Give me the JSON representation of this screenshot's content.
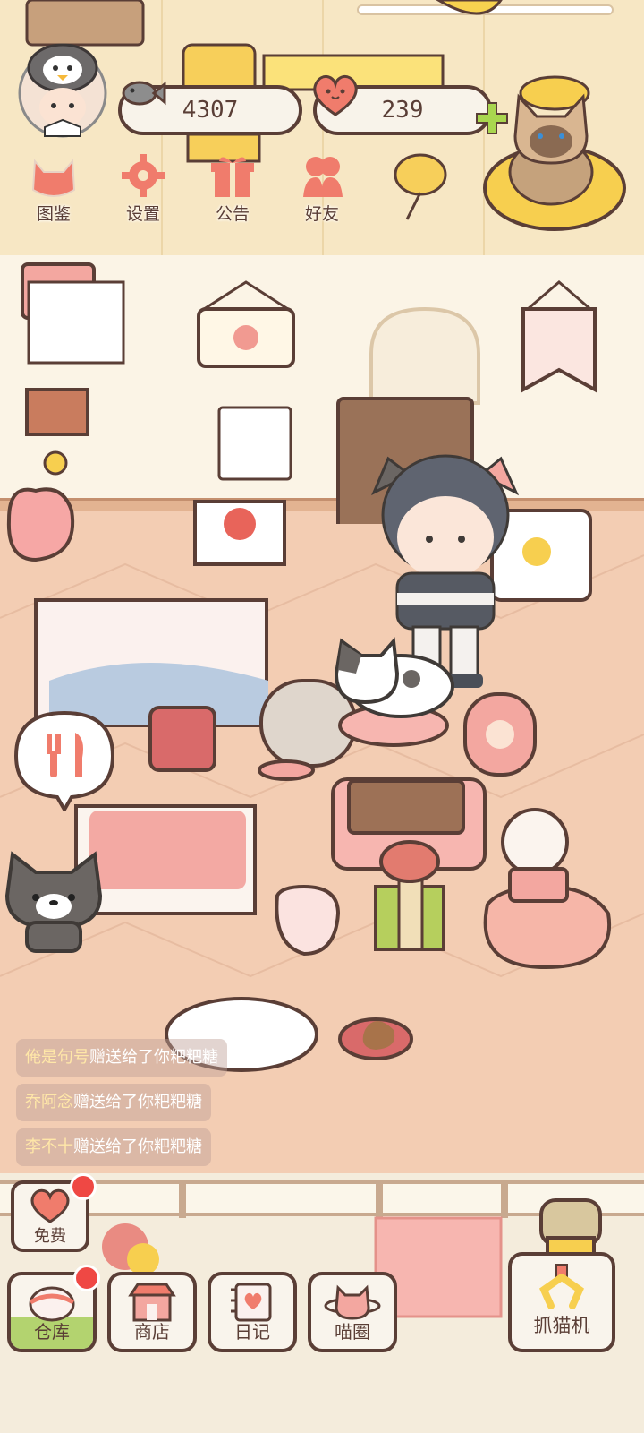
{
  "currency": {
    "fish_coins": "4307",
    "hearts": "239"
  },
  "menu": [
    {
      "label": "图鉴",
      "icon": "cat-head-icon"
    },
    {
      "label": "设置",
      "icon": "gear-icon"
    },
    {
      "label": "公告",
      "icon": "gift-icon"
    },
    {
      "label": "好友",
      "icon": "friends-icon"
    }
  ],
  "chat": [
    {
      "name": "俺是句号",
      "text": "赠送给了你粑粑糖"
    },
    {
      "name": "乔阿念",
      "text": "赠送给了你粑粑糖"
    },
    {
      "name": "李不十",
      "text": "赠送给了你粑粑糖"
    }
  ],
  "free_button": {
    "label": "免费"
  },
  "bottom_bar": [
    {
      "label": "仓库",
      "icon": "warehouse-icon"
    },
    {
      "label": "商店",
      "icon": "shop-icon"
    },
    {
      "label": "日记",
      "icon": "diary-icon"
    },
    {
      "label": "喵圈",
      "icon": "cat-planet-icon"
    }
  ],
  "claw_machine": {
    "label": "抓猫机",
    "icon": "claw-icon"
  },
  "colors": {
    "outline": "#5a3e36",
    "accent_pink": "#f07c6c",
    "badge_red": "#ef4844",
    "floor": "#f3cdb3",
    "wall": "#fbf4e6"
  }
}
